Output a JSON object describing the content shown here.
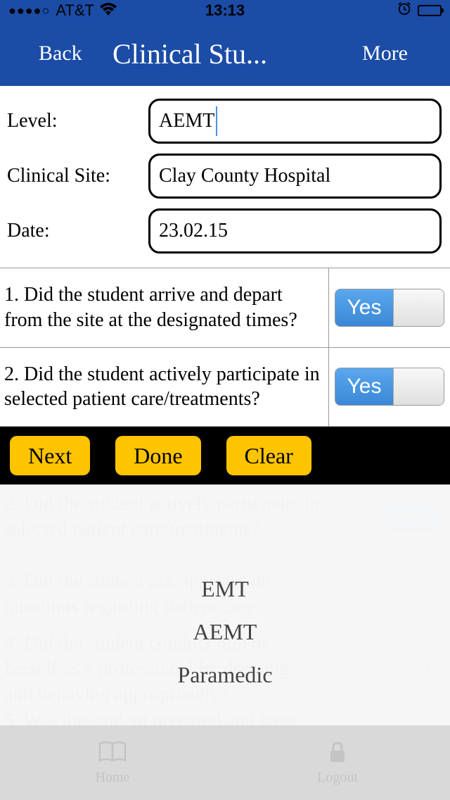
{
  "status": {
    "carrier": "AT&T",
    "time": "13:13"
  },
  "nav": {
    "back": "Back",
    "title": "Clinical Stu...",
    "more": "More"
  },
  "form": {
    "level_label": "Level:",
    "level_value": "AEMT",
    "site_label": "Clinical  Site:",
    "site_value": "Clay County Hospital",
    "date_label": "Date:",
    "date_value": "23.02.15"
  },
  "questions": [
    {
      "text": "1. Did the student arrive and depart from the site at the designated times?",
      "toggle": "Yes"
    },
    {
      "text": "2. Did the student actively participate in selected patient care/treatments?",
      "toggle": "Yes"
    }
  ],
  "actions": {
    "next": "Next",
    "done": "Done",
    "clear": "Clear"
  },
  "bg_questions": {
    "q1": "2. Did the student actively participate in selected patient care/treatments?",
    "q2": "3. Did the student ask appropriate questions regarding patient care?",
    "q3": "4. Did the student conduct him or herself as a professional by dressing and behaving appropriately?",
    "q4": "5. Was the student prepared and have",
    "yes": "Yes",
    "no": "No"
  },
  "picker": {
    "opt1": "EMT",
    "opt2": "AEMT",
    "opt3": "Paramedic"
  },
  "tabs": {
    "home": "Home",
    "logout": "Logout"
  }
}
